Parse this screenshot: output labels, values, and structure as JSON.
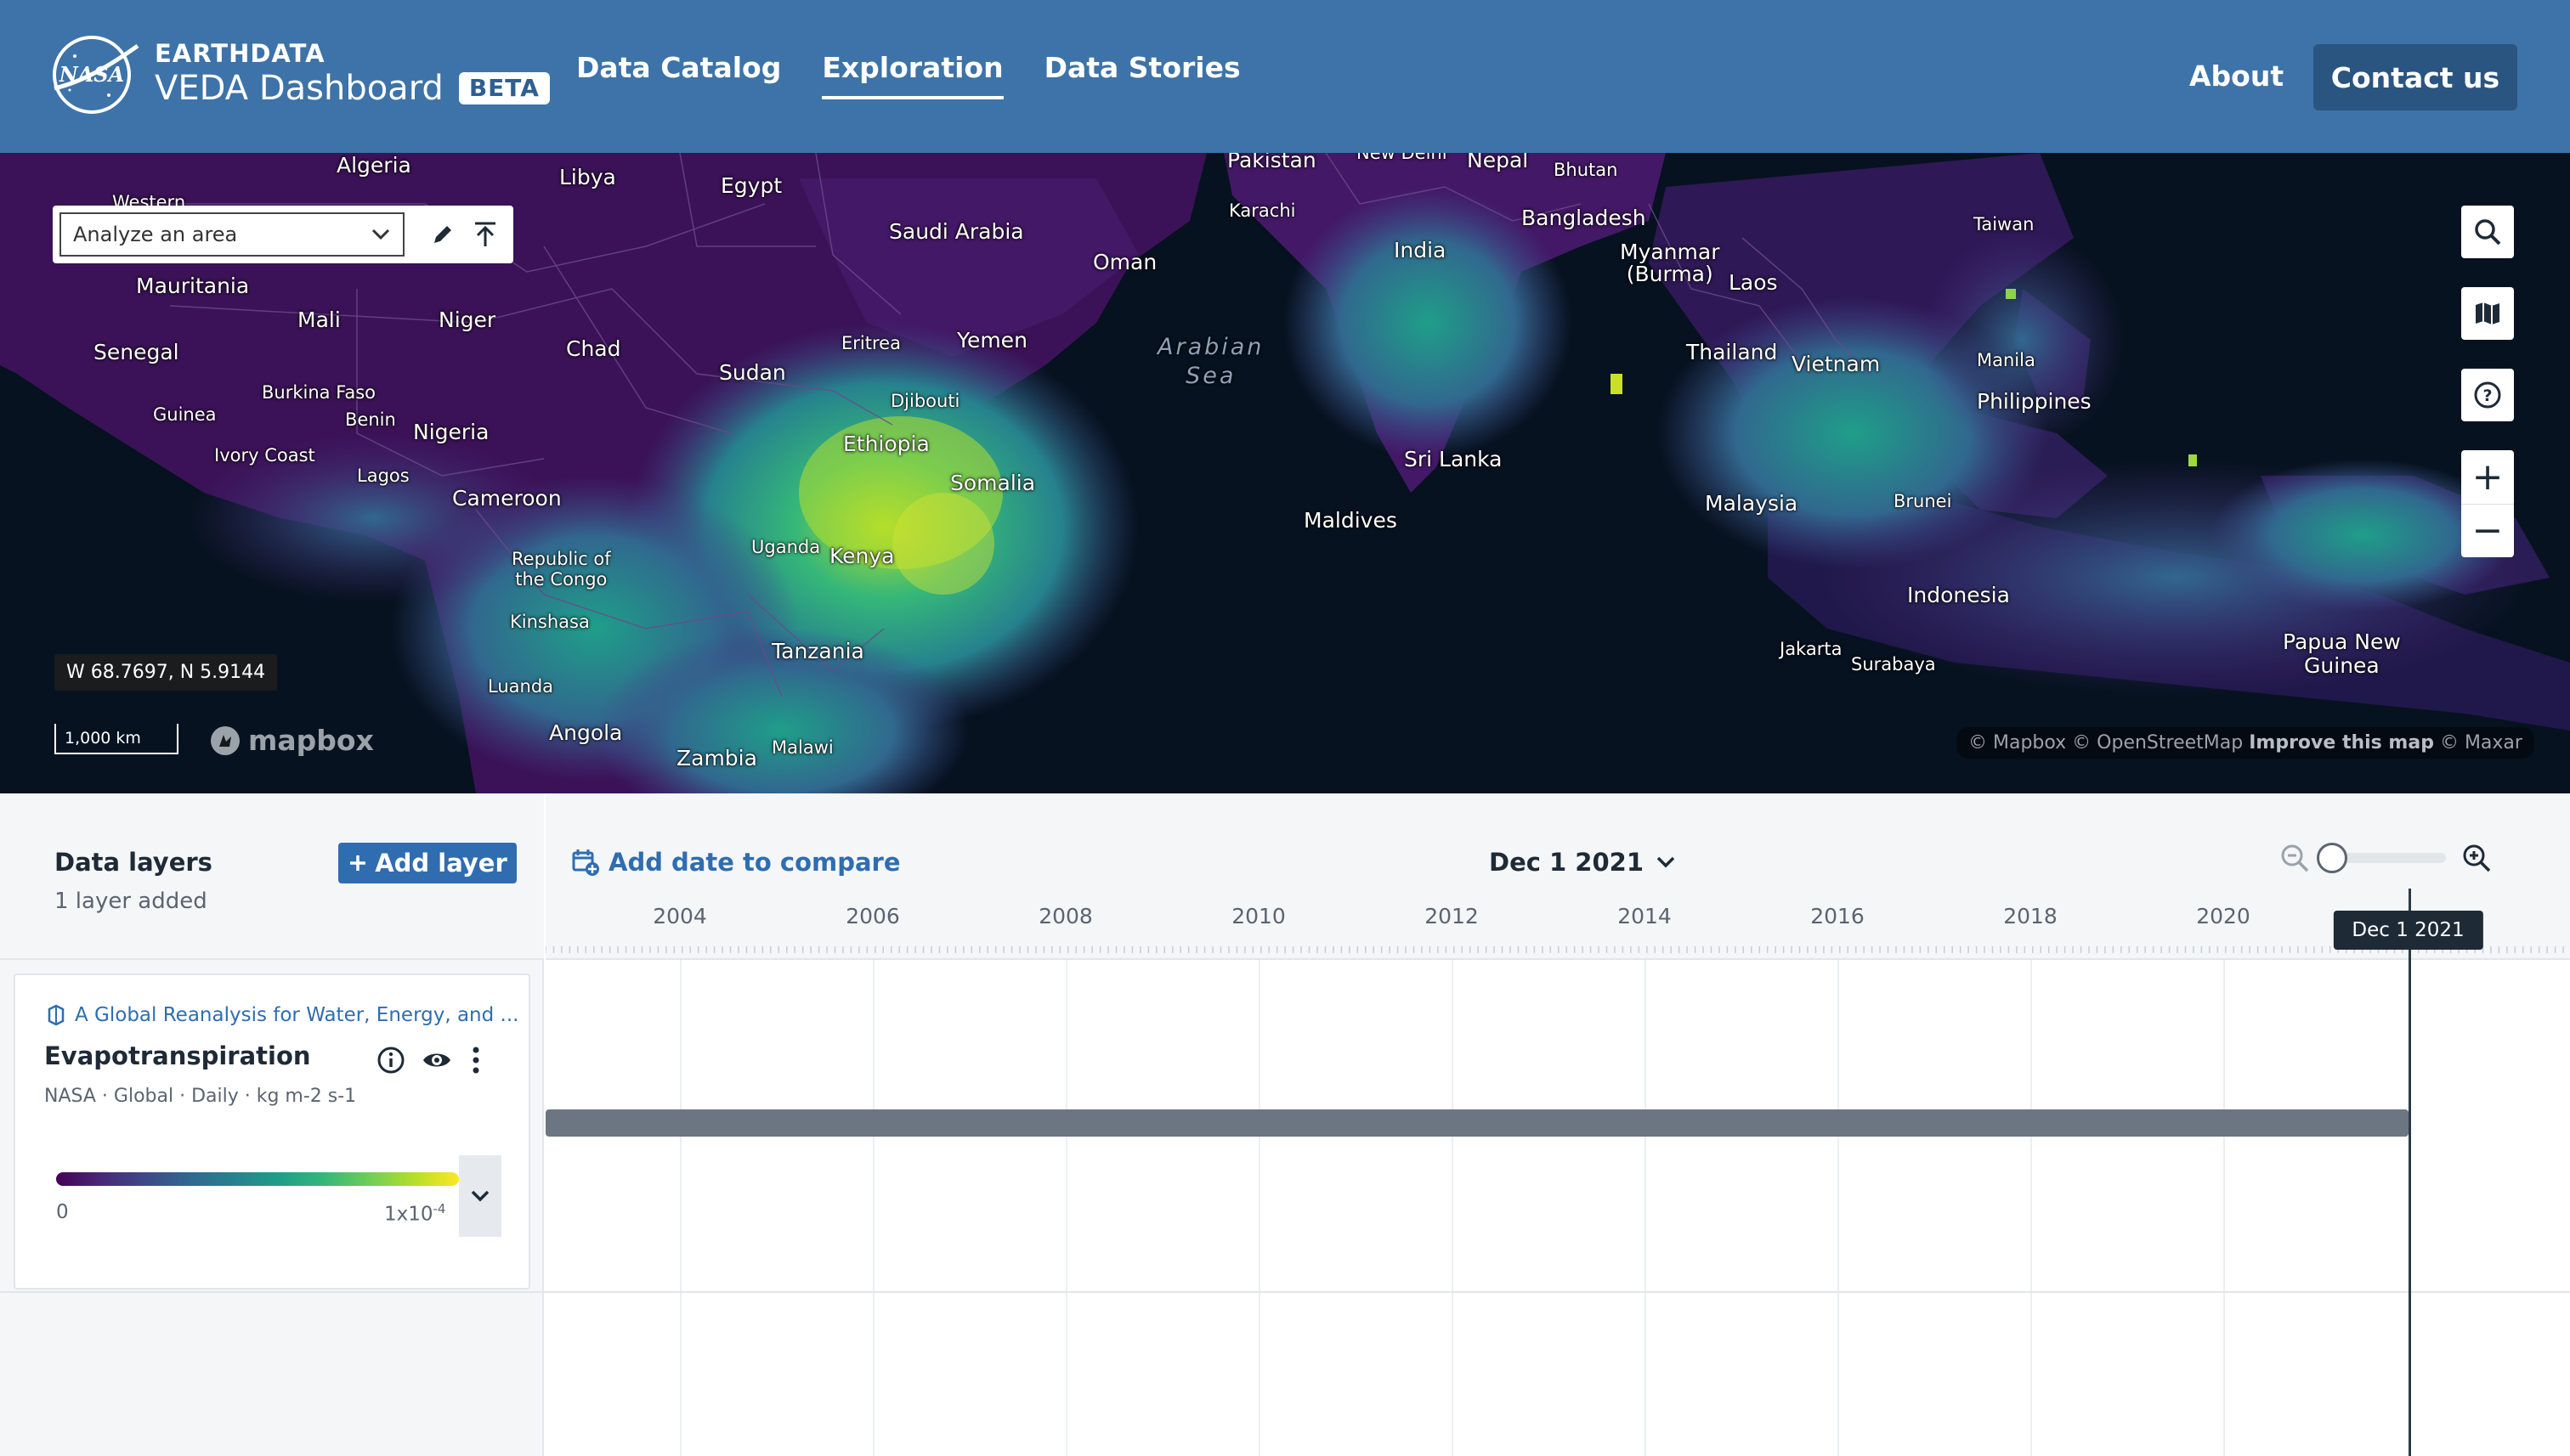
{
  "header": {
    "brand_top": "EARTHDATA",
    "brand_name": "VEDA Dashboard",
    "badge": "BETA",
    "nav": [
      {
        "label": "Data Catalog",
        "active": false
      },
      {
        "label": "Exploration",
        "active": true
      },
      {
        "label": "Data Stories",
        "active": false
      }
    ],
    "about": "About",
    "contact": "Contact us",
    "colors": {
      "header_bg": "#3d73a8",
      "contact_bg": "#2a5580"
    }
  },
  "map": {
    "analyze_placeholder": "Analyze an area",
    "tool_icons": [
      "pencil-icon",
      "upload-icon"
    ],
    "controls": [
      "search-icon",
      "map-icon",
      "help-icon",
      "zoom-in-icon",
      "zoom-out-icon"
    ],
    "zoom_in": "+",
    "zoom_out": "−",
    "coords": "W 68.7697, N 5.9144",
    "scale": "1,000 km",
    "logo": "mapbox",
    "attribution_a": "© Mapbox © OpenStreetMap",
    "attribution_b": "Improve this map",
    "attribution_c": "© Maxar",
    "labels": [
      {
        "text": "Algeria",
        "cls": ""
      },
      {
        "text": "Libya",
        "cls": ""
      },
      {
        "text": "Egypt",
        "cls": ""
      },
      {
        "text": "Western",
        "cls": "small"
      },
      {
        "text": "Pakistan",
        "cls": ""
      },
      {
        "text": "New Delhi",
        "cls": "small"
      },
      {
        "text": "Nepal",
        "cls": ""
      },
      {
        "text": "Bhutan",
        "cls": "small"
      },
      {
        "text": "Saudi Arabia",
        "cls": ""
      },
      {
        "text": "Karachi",
        "cls": "small"
      },
      {
        "text": "Bangladesh",
        "cls": ""
      },
      {
        "text": "Taiwan",
        "cls": "small"
      },
      {
        "text": "Mauritania",
        "cls": ""
      },
      {
        "text": "Oman",
        "cls": ""
      },
      {
        "text": "India",
        "cls": ""
      },
      {
        "text": "Myanmar\n(Burma)",
        "cls": ""
      },
      {
        "text": "Laos",
        "cls": ""
      },
      {
        "text": "Mali",
        "cls": ""
      },
      {
        "text": "Niger",
        "cls": ""
      },
      {
        "text": "Senegal",
        "cls": ""
      },
      {
        "text": "Chad",
        "cls": ""
      },
      {
        "text": "Eritrea",
        "cls": "small"
      },
      {
        "text": "Yemen",
        "cls": ""
      },
      {
        "text": "Thailand",
        "cls": ""
      },
      {
        "text": "Vietnam",
        "cls": ""
      },
      {
        "text": "Manila",
        "cls": "small"
      },
      {
        "text": "Sudan",
        "cls": ""
      },
      {
        "text": "Burkina Faso",
        "cls": "small"
      },
      {
        "text": "Djibouti",
        "cls": "small"
      },
      {
        "text": "Philippines",
        "cls": ""
      },
      {
        "text": "Guinea",
        "cls": "small"
      },
      {
        "text": "Benin",
        "cls": "small"
      },
      {
        "text": "Nigeria",
        "cls": ""
      },
      {
        "text": "Ethiopia",
        "cls": ""
      },
      {
        "text": "Ivory Coast",
        "cls": "small"
      },
      {
        "text": "Lagos",
        "cls": "small"
      },
      {
        "text": "Sri Lanka",
        "cls": ""
      },
      {
        "text": "Somalia",
        "cls": ""
      },
      {
        "text": "Cameroon",
        "cls": ""
      },
      {
        "text": "Malaysia",
        "cls": ""
      },
      {
        "text": "Brunei",
        "cls": "small"
      },
      {
        "text": "Maldives",
        "cls": ""
      },
      {
        "text": "Uganda",
        "cls": "small"
      },
      {
        "text": "Republic of\nthe Congo",
        "cls": "small"
      },
      {
        "text": "Kenya",
        "cls": ""
      },
      {
        "text": "Indonesia",
        "cls": ""
      },
      {
        "text": "Kinshasa",
        "cls": "small"
      },
      {
        "text": "Papua New\nGuinea",
        "cls": ""
      },
      {
        "text": "Tanzania",
        "cls": ""
      },
      {
        "text": "Jakarta",
        "cls": "small"
      },
      {
        "text": "Surabaya",
        "cls": "small"
      },
      {
        "text": "Luanda",
        "cls": "small"
      },
      {
        "text": "Angola",
        "cls": ""
      },
      {
        "text": "Zambia",
        "cls": ""
      },
      {
        "text": "Malawi",
        "cls": "small"
      },
      {
        "text": "Arabian\nSea",
        "cls": "sea"
      }
    ]
  },
  "layers": {
    "title": "Data layers",
    "subtitle": "1 layer added",
    "add_button": "Add layer",
    "card": {
      "source": "A Global Reanalysis for Water, Energy, and ...",
      "name": "Evapotranspiration",
      "meta": "NASA · Global · Daily · kg m-2 s-1",
      "legend_min": "0",
      "legend_max_base": "1x10",
      "legend_max_exp": "-4",
      "icons": [
        "info-icon",
        "eye-icon",
        "more-vertical-icon"
      ],
      "colormap": [
        "#440154",
        "#31688e",
        "#1f9e89",
        "#6ece58",
        "#fde725"
      ]
    }
  },
  "timeline": {
    "add_date": "Add date to compare",
    "selected_date": "Dec 1 2021",
    "years": [
      "2004",
      "2006",
      "2008",
      "2010",
      "2012",
      "2014",
      "2016",
      "2018",
      "2020"
    ],
    "current_marker": "Dec 1 2021",
    "data_coverage_end": "Dec 1 2021",
    "zoom_level": 0
  }
}
